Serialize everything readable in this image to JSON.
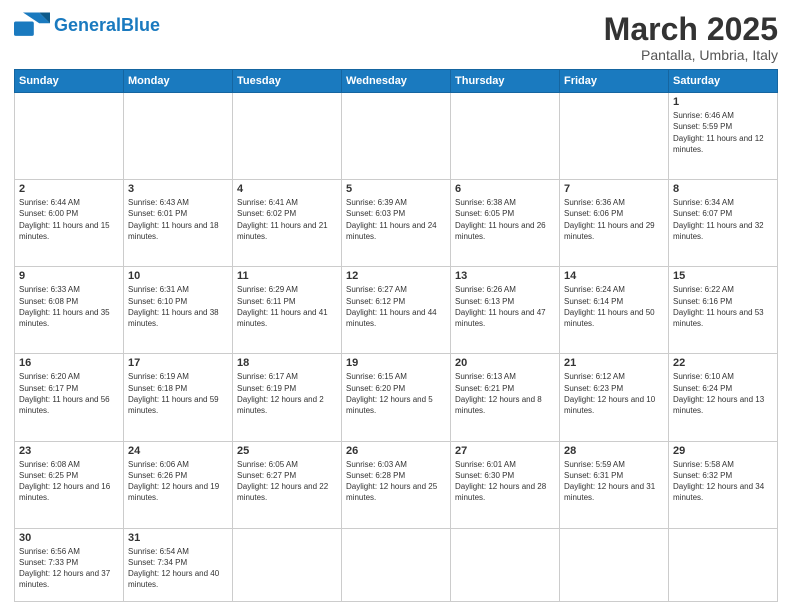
{
  "header": {
    "logo_general": "General",
    "logo_blue": "Blue",
    "main_title": "March 2025",
    "subtitle": "Pantalla, Umbria, Italy"
  },
  "weekdays": [
    "Sunday",
    "Monday",
    "Tuesday",
    "Wednesday",
    "Thursday",
    "Friday",
    "Saturday"
  ],
  "days": {
    "d1": {
      "n": "1",
      "sr": "6:46 AM",
      "ss": "5:59 PM",
      "dl": "11 hours and 12 minutes."
    },
    "d2": {
      "n": "2",
      "sr": "6:44 AM",
      "ss": "6:00 PM",
      "dl": "11 hours and 15 minutes."
    },
    "d3": {
      "n": "3",
      "sr": "6:43 AM",
      "ss": "6:01 PM",
      "dl": "11 hours and 18 minutes."
    },
    "d4": {
      "n": "4",
      "sr": "6:41 AM",
      "ss": "6:02 PM",
      "dl": "11 hours and 21 minutes."
    },
    "d5": {
      "n": "5",
      "sr": "6:39 AM",
      "ss": "6:03 PM",
      "dl": "11 hours and 24 minutes."
    },
    "d6": {
      "n": "6",
      "sr": "6:38 AM",
      "ss": "6:05 PM",
      "dl": "11 hours and 26 minutes."
    },
    "d7": {
      "n": "7",
      "sr": "6:36 AM",
      "ss": "6:06 PM",
      "dl": "11 hours and 29 minutes."
    },
    "d8": {
      "n": "8",
      "sr": "6:34 AM",
      "ss": "6:07 PM",
      "dl": "11 hours and 32 minutes."
    },
    "d9": {
      "n": "9",
      "sr": "6:33 AM",
      "ss": "6:08 PM",
      "dl": "11 hours and 35 minutes."
    },
    "d10": {
      "n": "10",
      "sr": "6:31 AM",
      "ss": "6:10 PM",
      "dl": "11 hours and 38 minutes."
    },
    "d11": {
      "n": "11",
      "sr": "6:29 AM",
      "ss": "6:11 PM",
      "dl": "11 hours and 41 minutes."
    },
    "d12": {
      "n": "12",
      "sr": "6:27 AM",
      "ss": "6:12 PM",
      "dl": "11 hours and 44 minutes."
    },
    "d13": {
      "n": "13",
      "sr": "6:26 AM",
      "ss": "6:13 PM",
      "dl": "11 hours and 47 minutes."
    },
    "d14": {
      "n": "14",
      "sr": "6:24 AM",
      "ss": "6:14 PM",
      "dl": "11 hours and 50 minutes."
    },
    "d15": {
      "n": "15",
      "sr": "6:22 AM",
      "ss": "6:16 PM",
      "dl": "11 hours and 53 minutes."
    },
    "d16": {
      "n": "16",
      "sr": "6:20 AM",
      "ss": "6:17 PM",
      "dl": "11 hours and 56 minutes."
    },
    "d17": {
      "n": "17",
      "sr": "6:19 AM",
      "ss": "6:18 PM",
      "dl": "11 hours and 59 minutes."
    },
    "d18": {
      "n": "18",
      "sr": "6:17 AM",
      "ss": "6:19 PM",
      "dl": "12 hours and 2 minutes."
    },
    "d19": {
      "n": "19",
      "sr": "6:15 AM",
      "ss": "6:20 PM",
      "dl": "12 hours and 5 minutes."
    },
    "d20": {
      "n": "20",
      "sr": "6:13 AM",
      "ss": "6:21 PM",
      "dl": "12 hours and 8 minutes."
    },
    "d21": {
      "n": "21",
      "sr": "6:12 AM",
      "ss": "6:23 PM",
      "dl": "12 hours and 10 minutes."
    },
    "d22": {
      "n": "22",
      "sr": "6:10 AM",
      "ss": "6:24 PM",
      "dl": "12 hours and 13 minutes."
    },
    "d23": {
      "n": "23",
      "sr": "6:08 AM",
      "ss": "6:25 PM",
      "dl": "12 hours and 16 minutes."
    },
    "d24": {
      "n": "24",
      "sr": "6:06 AM",
      "ss": "6:26 PM",
      "dl": "12 hours and 19 minutes."
    },
    "d25": {
      "n": "25",
      "sr": "6:05 AM",
      "ss": "6:27 PM",
      "dl": "12 hours and 22 minutes."
    },
    "d26": {
      "n": "26",
      "sr": "6:03 AM",
      "ss": "6:28 PM",
      "dl": "12 hours and 25 minutes."
    },
    "d27": {
      "n": "27",
      "sr": "6:01 AM",
      "ss": "6:30 PM",
      "dl": "12 hours and 28 minutes."
    },
    "d28": {
      "n": "28",
      "sr": "5:59 AM",
      "ss": "6:31 PM",
      "dl": "12 hours and 31 minutes."
    },
    "d29": {
      "n": "29",
      "sr": "5:58 AM",
      "ss": "6:32 PM",
      "dl": "12 hours and 34 minutes."
    },
    "d30": {
      "n": "30",
      "sr": "6:56 AM",
      "ss": "7:33 PM",
      "dl": "12 hours and 37 minutes."
    },
    "d31": {
      "n": "31",
      "sr": "6:54 AM",
      "ss": "7:34 PM",
      "dl": "12 hours and 40 minutes."
    }
  }
}
